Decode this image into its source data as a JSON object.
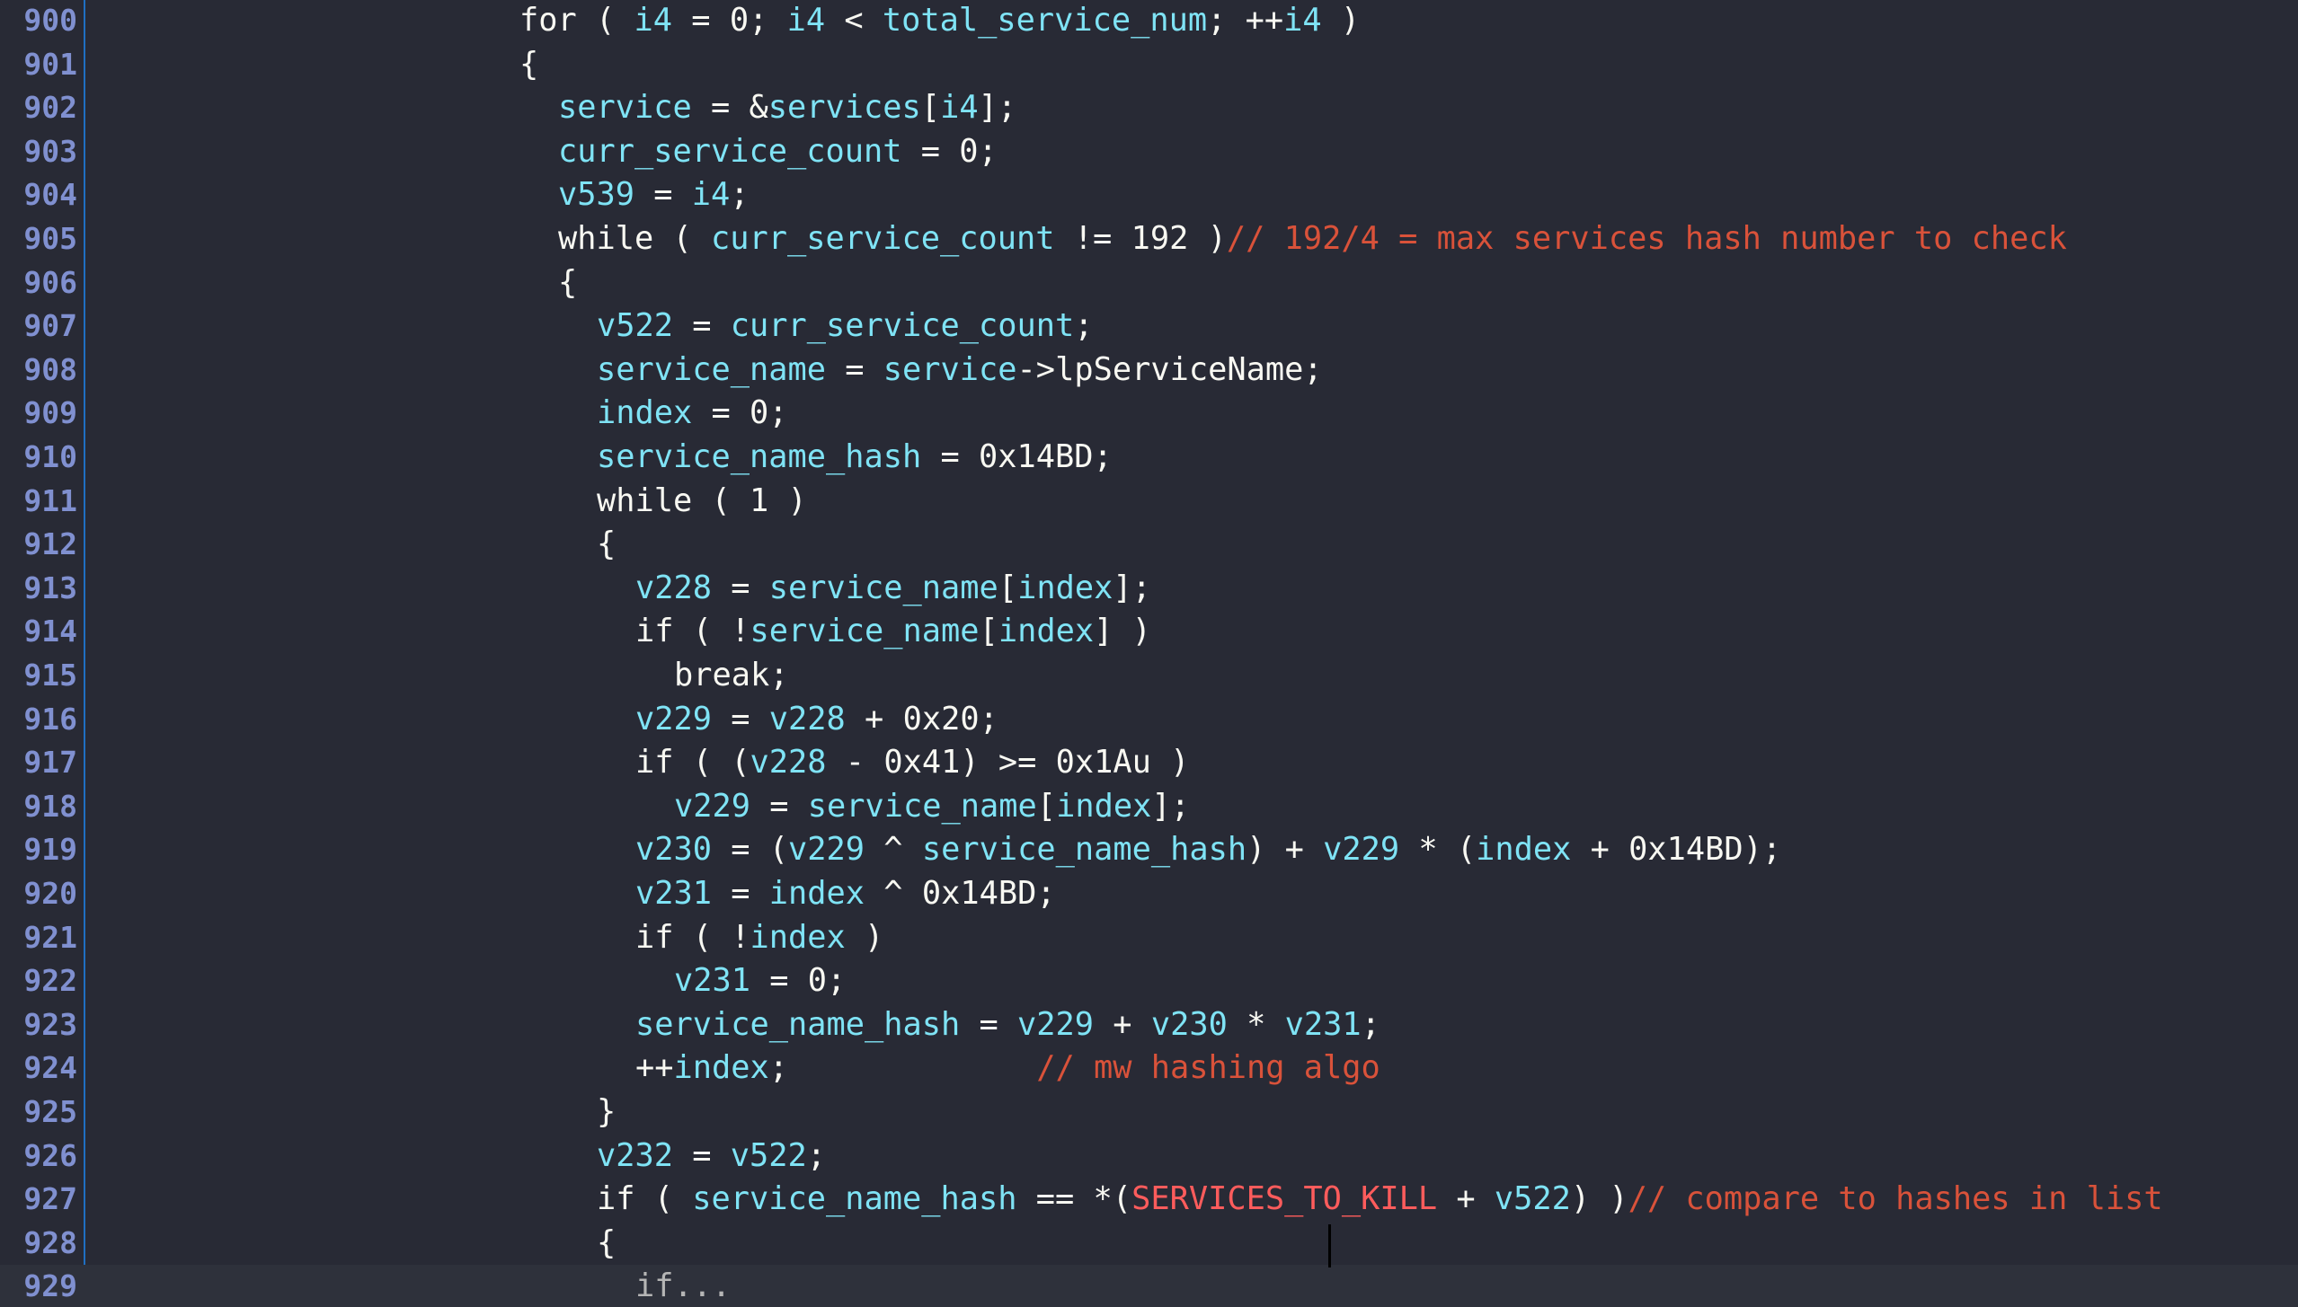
{
  "editor": {
    "theme_colors": {
      "background": "#282a35",
      "line_number": "#8090d0",
      "identifier": "#7fe3f5",
      "comment": "#d9523a",
      "constant": "#ff5c5c",
      "plain": "#f8f8f2",
      "current_line": "#2e313b"
    },
    "current_line_number": 929,
    "lines": [
      {
        "num": "900",
        "indent": 0,
        "tokens": [
          [
            "kw",
            "for"
          ],
          [
            "op",
            " ( "
          ],
          [
            "id",
            "i4"
          ],
          [
            "op",
            " = "
          ],
          [
            "num",
            "0"
          ],
          [
            "op",
            "; "
          ],
          [
            "id",
            "i4"
          ],
          [
            "op",
            " < "
          ],
          [
            "id",
            "total_service_num"
          ],
          [
            "op",
            "; ++"
          ],
          [
            "id",
            "i4"
          ],
          [
            "op",
            " )"
          ]
        ]
      },
      {
        "num": "901",
        "indent": 0,
        "tokens": [
          [
            "op",
            "{"
          ]
        ]
      },
      {
        "num": "902",
        "indent": 1,
        "tokens": [
          [
            "id",
            "service"
          ],
          [
            "op",
            " = &"
          ],
          [
            "id",
            "services"
          ],
          [
            "op",
            "["
          ],
          [
            "id",
            "i4"
          ],
          [
            "op",
            "];"
          ]
        ]
      },
      {
        "num": "903",
        "indent": 1,
        "tokens": [
          [
            "id",
            "curr_service_count"
          ],
          [
            "op",
            " = "
          ],
          [
            "num",
            "0"
          ],
          [
            "op",
            ";"
          ]
        ]
      },
      {
        "num": "904",
        "indent": 1,
        "tokens": [
          [
            "id",
            "v539"
          ],
          [
            "op",
            " = "
          ],
          [
            "id",
            "i4"
          ],
          [
            "op",
            ";"
          ]
        ]
      },
      {
        "num": "905",
        "indent": 1,
        "tokens": [
          [
            "kw",
            "while"
          ],
          [
            "op",
            " ( "
          ],
          [
            "id",
            "curr_service_count"
          ],
          [
            "op",
            " != "
          ],
          [
            "num",
            "192"
          ],
          [
            "op",
            " )"
          ],
          [
            "cmt",
            "// 192/4 = max services hash number to check"
          ]
        ]
      },
      {
        "num": "906",
        "indent": 1,
        "tokens": [
          [
            "op",
            "{"
          ]
        ]
      },
      {
        "num": "907",
        "indent": 2,
        "tokens": [
          [
            "id",
            "v522"
          ],
          [
            "op",
            " = "
          ],
          [
            "id",
            "curr_service_count"
          ],
          [
            "op",
            ";"
          ]
        ]
      },
      {
        "num": "908",
        "indent": 2,
        "tokens": [
          [
            "id",
            "service_name"
          ],
          [
            "op",
            " = "
          ],
          [
            "id",
            "service"
          ],
          [
            "op",
            "->"
          ],
          [
            "field",
            "lpServiceName"
          ],
          [
            "op",
            ";"
          ]
        ]
      },
      {
        "num": "909",
        "indent": 2,
        "tokens": [
          [
            "id",
            "index"
          ],
          [
            "op",
            " = "
          ],
          [
            "num",
            "0"
          ],
          [
            "op",
            ";"
          ]
        ]
      },
      {
        "num": "910",
        "indent": 2,
        "tokens": [
          [
            "id",
            "service_name_hash"
          ],
          [
            "op",
            " = "
          ],
          [
            "num",
            "0x14BD"
          ],
          [
            "op",
            ";"
          ]
        ]
      },
      {
        "num": "911",
        "indent": 2,
        "tokens": [
          [
            "kw",
            "while"
          ],
          [
            "op",
            " ( "
          ],
          [
            "num",
            "1"
          ],
          [
            "op",
            " )"
          ]
        ]
      },
      {
        "num": "912",
        "indent": 2,
        "tokens": [
          [
            "op",
            "{"
          ]
        ]
      },
      {
        "num": "913",
        "indent": 3,
        "tokens": [
          [
            "id",
            "v228"
          ],
          [
            "op",
            " = "
          ],
          [
            "id",
            "service_name"
          ],
          [
            "op",
            "["
          ],
          [
            "id",
            "index"
          ],
          [
            "op",
            "];"
          ]
        ]
      },
      {
        "num": "914",
        "indent": 3,
        "tokens": [
          [
            "kw",
            "if"
          ],
          [
            "op",
            " ( !"
          ],
          [
            "id",
            "service_name"
          ],
          [
            "op",
            "["
          ],
          [
            "id",
            "index"
          ],
          [
            "op",
            "] )"
          ]
        ]
      },
      {
        "num": "915",
        "indent": 4,
        "tokens": [
          [
            "kw",
            "break"
          ],
          [
            "op",
            ";"
          ]
        ]
      },
      {
        "num": "916",
        "indent": 3,
        "tokens": [
          [
            "id",
            "v229"
          ],
          [
            "op",
            " = "
          ],
          [
            "id",
            "v228"
          ],
          [
            "op",
            " + "
          ],
          [
            "num",
            "0x20"
          ],
          [
            "op",
            ";"
          ]
        ]
      },
      {
        "num": "917",
        "indent": 3,
        "tokens": [
          [
            "kw",
            "if"
          ],
          [
            "op",
            " ( ("
          ],
          [
            "id",
            "v228"
          ],
          [
            "op",
            " - "
          ],
          [
            "num",
            "0x41"
          ],
          [
            "op",
            ") >= "
          ],
          [
            "num",
            "0x1Au"
          ],
          [
            "op",
            " )"
          ]
        ]
      },
      {
        "num": "918",
        "indent": 4,
        "tokens": [
          [
            "id",
            "v229"
          ],
          [
            "op",
            " = "
          ],
          [
            "id",
            "service_name"
          ],
          [
            "op",
            "["
          ],
          [
            "id",
            "index"
          ],
          [
            "op",
            "];"
          ]
        ]
      },
      {
        "num": "919",
        "indent": 3,
        "tokens": [
          [
            "id",
            "v230"
          ],
          [
            "op",
            " = ("
          ],
          [
            "id",
            "v229"
          ],
          [
            "op",
            " ^ "
          ],
          [
            "id",
            "service_name_hash"
          ],
          [
            "op",
            ") + "
          ],
          [
            "id",
            "v229"
          ],
          [
            "op",
            " * ("
          ],
          [
            "id",
            "index"
          ],
          [
            "op",
            " + "
          ],
          [
            "num",
            "0x14BD"
          ],
          [
            "op",
            ");"
          ]
        ]
      },
      {
        "num": "920",
        "indent": 3,
        "tokens": [
          [
            "id",
            "v231"
          ],
          [
            "op",
            " = "
          ],
          [
            "id",
            "index"
          ],
          [
            "op",
            " ^ "
          ],
          [
            "num",
            "0x14BD"
          ],
          [
            "op",
            ";"
          ]
        ]
      },
      {
        "num": "921",
        "indent": 3,
        "tokens": [
          [
            "kw",
            "if"
          ],
          [
            "op",
            " ( !"
          ],
          [
            "id",
            "index"
          ],
          [
            "op",
            " )"
          ]
        ]
      },
      {
        "num": "922",
        "indent": 4,
        "tokens": [
          [
            "id",
            "v231"
          ],
          [
            "op",
            " = "
          ],
          [
            "num",
            "0"
          ],
          [
            "op",
            ";"
          ]
        ]
      },
      {
        "num": "923",
        "indent": 3,
        "tokens": [
          [
            "id",
            "service_name_hash"
          ],
          [
            "op",
            " = "
          ],
          [
            "id",
            "v229"
          ],
          [
            "op",
            " + "
          ],
          [
            "id",
            "v230"
          ],
          [
            "op",
            " * "
          ],
          [
            "id",
            "v231"
          ],
          [
            "op",
            ";"
          ]
        ]
      },
      {
        "num": "924",
        "indent": 3,
        "tokens": [
          [
            "op",
            "++"
          ],
          [
            "id",
            "index"
          ],
          [
            "op",
            ";             "
          ],
          [
            "cmt",
            "// mw hashing algo"
          ]
        ]
      },
      {
        "num": "925",
        "indent": 2,
        "tokens": [
          [
            "op",
            "}"
          ]
        ]
      },
      {
        "num": "926",
        "indent": 2,
        "tokens": [
          [
            "id",
            "v232"
          ],
          [
            "op",
            " = "
          ],
          [
            "id",
            "v522"
          ],
          [
            "op",
            ";"
          ]
        ]
      },
      {
        "num": "927",
        "indent": 2,
        "tokens": [
          [
            "kw",
            "if"
          ],
          [
            "op",
            " ( "
          ],
          [
            "id",
            "service_name_hash"
          ],
          [
            "op",
            " == *("
          ],
          [
            "const",
            "SERVICES_TO_KILL"
          ],
          [
            "op",
            " + "
          ],
          [
            "id",
            "v522"
          ],
          [
            "op",
            ") )"
          ],
          [
            "cmt",
            "// compare to hashes in list"
          ]
        ]
      },
      {
        "num": "928",
        "indent": 2,
        "tokens": [
          [
            "op",
            "{"
          ]
        ]
      },
      {
        "num": "929",
        "indent": 3,
        "tokens": [
          [
            "fold",
            "if..."
          ]
        ]
      }
    ]
  }
}
